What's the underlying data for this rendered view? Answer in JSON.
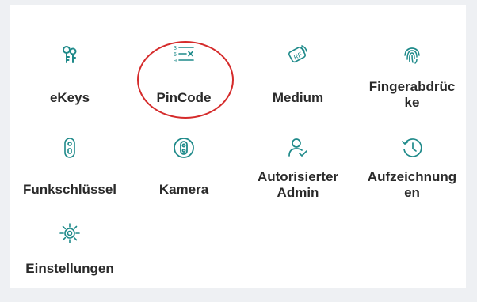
{
  "grid": {
    "items": [
      {
        "label": "eKeys",
        "icon": "keys-icon"
      },
      {
        "label": "PinCode",
        "icon": "pin-list-icon"
      },
      {
        "label": "Medium",
        "icon": "rf-card-icon"
      },
      {
        "label_line1": "Fingerabdrüc",
        "label_line2": "ke",
        "icon": "fingerprint-icon"
      },
      {
        "label": "Funkschlüssel",
        "icon": "remote-key-icon"
      },
      {
        "label": "Kamera",
        "icon": "camera-icon"
      },
      {
        "label_line1": "Autorisierter",
        "label_line2": "Admin",
        "icon": "admin-user-icon"
      },
      {
        "label_line1": "Aufzeichnung",
        "label_line2": "en",
        "icon": "history-clock-icon"
      },
      {
        "label": "Einstellungen",
        "icon": "settings-gear-icon"
      }
    ]
  },
  "colors": {
    "accent": "#1f8a8a",
    "text": "#2a2a2a",
    "highlight": "#d52b2b",
    "background": "#ffffff"
  }
}
